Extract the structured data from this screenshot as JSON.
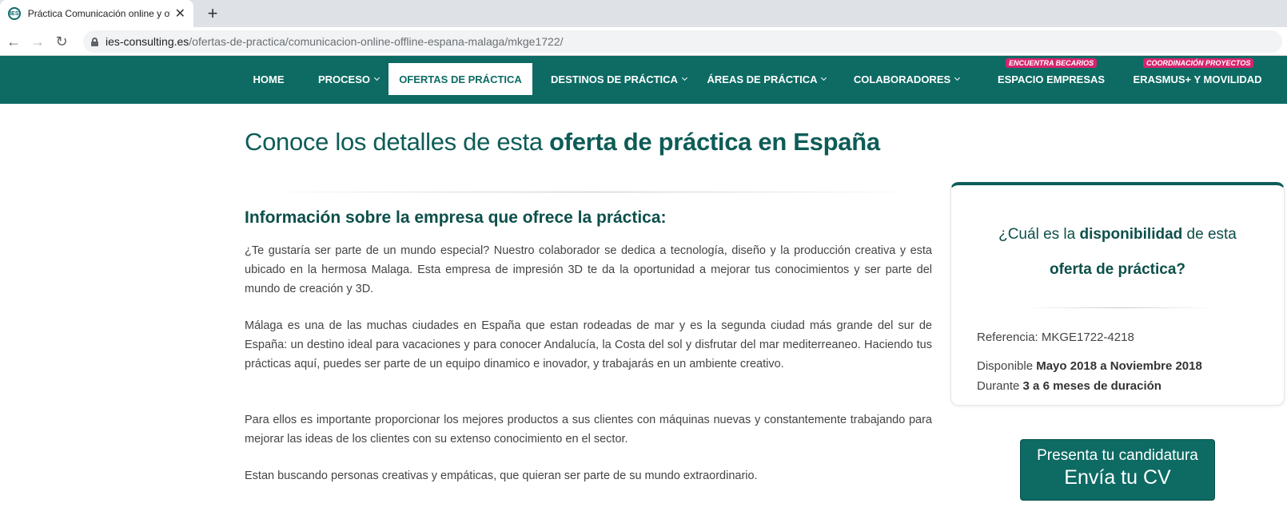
{
  "browser": {
    "tab_title": "Práctica Comunicación online y offline España Málaga",
    "favicon_text": "IES",
    "url_host": "ies-consulting.es",
    "url_path": "/ofertas-de-practica/comunicacion-online-offline-espana-malaga/mkge1722/"
  },
  "nav": {
    "items": [
      {
        "label": "HOME"
      },
      {
        "label": "PROCESO"
      },
      {
        "label": "OFERTAS DE PRÁCTICA"
      },
      {
        "label": "DESTINOS DE PRÁCTICA"
      },
      {
        "label": "ÁREAS DE PRÁCTICA"
      },
      {
        "label": "COLABORADORES"
      },
      {
        "label": "ESPACIO EMPRESAS",
        "badge": "ENCUENTRA BECARIOS"
      },
      {
        "label": "ERASMUS+ Y MOVILIDAD",
        "badge": "COORDINACIÓN PROYECTOS"
      }
    ],
    "active_index": 2
  },
  "content": {
    "heading_normal": "Conoce los detalles de esta ",
    "heading_bold": "oferta de práctica en España",
    "section_title": "Información sobre la empresa que ofrece la práctica:",
    "paragraphs": [
      "¿Te gustaría ser parte de un mundo especial? Nuestro colaborador se dedica a tecnología, diseño y la producción creativa y esta ubicado en la hermosa Malaga. Esta empresa de impresión 3D te da la oportunidad a mejorar tus conocimientos y ser parte del mundo de creación y 3D.",
      "Málaga es una de las muchas ciudades en España que estan rodeadas de mar y es la segunda ciudad más grande del sur de España: un  destino ideal para vacaciones y para conocer Andalucía, la Costa del sol y disfrutar del mar mediterreaneo. Haciendo tus prácticas aquí, puedes ser parte de un equipo dinamico e inovador, y trabajarás en un ambiente creativo.",
      "Para ellos es importante proporcionar los mejores productos a sus clientes con máquinas nuevas y constantemente trabajando para mejorar las ideas de los clientes con su extenso conocimiento en el sector.",
      "Estan buscando personas creativas y empáticas, que quieran ser parte de su mundo extraordinario."
    ]
  },
  "card": {
    "q_part1": "¿Cuál es la ",
    "q_bold": "disponibilidad",
    "q_part2": " de esta",
    "q_line2": "oferta de práctica?",
    "referencia_label": "Referencia: ",
    "referencia_value": "MKGE1722-4218",
    "disponible_label": "Disponible ",
    "disponible_value": "Mayo 2018 a Noviembre 2018",
    "durante_label": "Durante ",
    "durante_value": "3 a 6 meses de duración"
  },
  "cta": {
    "line1": "Presenta tu candidatura",
    "line2": "Envía tu CV"
  },
  "colors": {
    "brand": "#0d6b64",
    "heading": "#0d5c57",
    "badge": "#d6246e"
  }
}
